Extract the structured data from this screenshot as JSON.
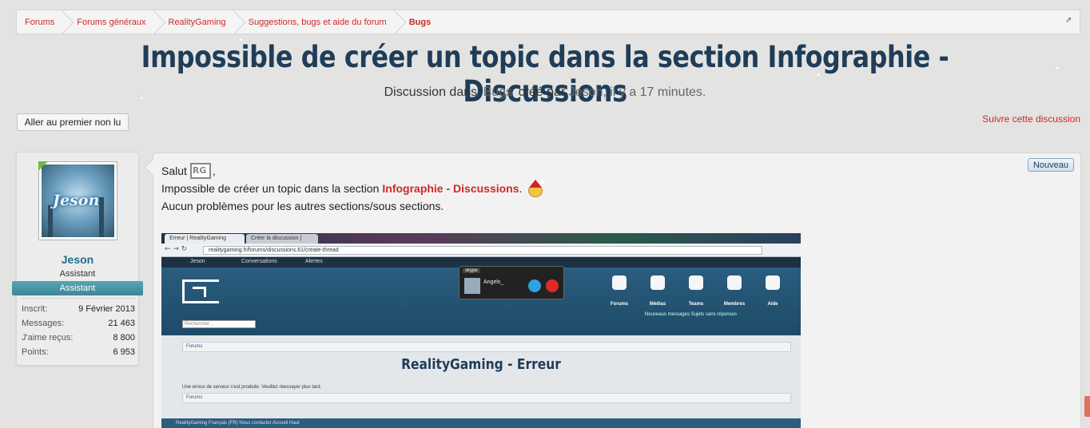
{
  "breadcrumb": {
    "items": [
      "Forums",
      "Forums généraux",
      "RealityGaming",
      "Suggestions, bugs et aide du forum",
      "Bugs"
    ]
  },
  "thread": {
    "title": "Impossible de créer un topic dans la section Infographie - Discussions",
    "desc_prefix": "Discussion dans '",
    "desc_forum": "Bugs",
    "desc_mid": "' créé par ",
    "desc_author": "Jeson",
    "desc_time": ", il y a 17 minutes."
  },
  "actions": {
    "first_unread": "Aller au premier non lu",
    "watch": "Suivre cette discussion"
  },
  "user": {
    "avatar_text": "Jeson",
    "name": "Jeson",
    "title": "Assistant",
    "banner": "Assistant",
    "stats": [
      {
        "label": "Inscrit:",
        "value": "9 Février 2013"
      },
      {
        "label": "Messages:",
        "value": "21 463"
      },
      {
        "label": "J'aime reçus:",
        "value": "8 800"
      },
      {
        "label": "Points:",
        "value": "6 953"
      }
    ]
  },
  "message": {
    "badge": "Nouveau",
    "greeting": "Salut",
    "greeting_suffix": ",",
    "line2_prefix": "Impossible de créer un topic dans la section",
    "line2_link": "Infographie - Discussions",
    "line2_suffix": ".",
    "line3": "Aucun problèmes pour les autres sections/sous sections."
  },
  "screenshot": {
    "tab1": "Erreur | RealityGaming",
    "tab2": "Créer la discussion | Rea",
    "url": "realitygaming.fr/forums/discussions.61/create-thread",
    "topbar_user": "Jeson",
    "topbar_conv": "Conversations",
    "topbar_alerts": "Alertes",
    "skype_header": "skype",
    "skype_name": "Angels_",
    "nav": [
      "Forums",
      "Médias",
      "Teams",
      "Membres",
      "Aide"
    ],
    "subnav": "Nouveaux messages    Sujets sans réponses",
    "search_placeholder": "Rechercher...",
    "crumb": "Forums",
    "error_title": "RealityGaming - Erreur",
    "error_msg": "Une erreur de serveur s'est produite. Veuillez réessayer plus tard.",
    "footer": "RealityGaming   Français (FR)   Nous contacter   Accueil   Haut"
  },
  "colors": {
    "link": "#d02828",
    "title": "#1f3d58",
    "username": "#1f6f8c",
    "banner": "#3d8696"
  }
}
